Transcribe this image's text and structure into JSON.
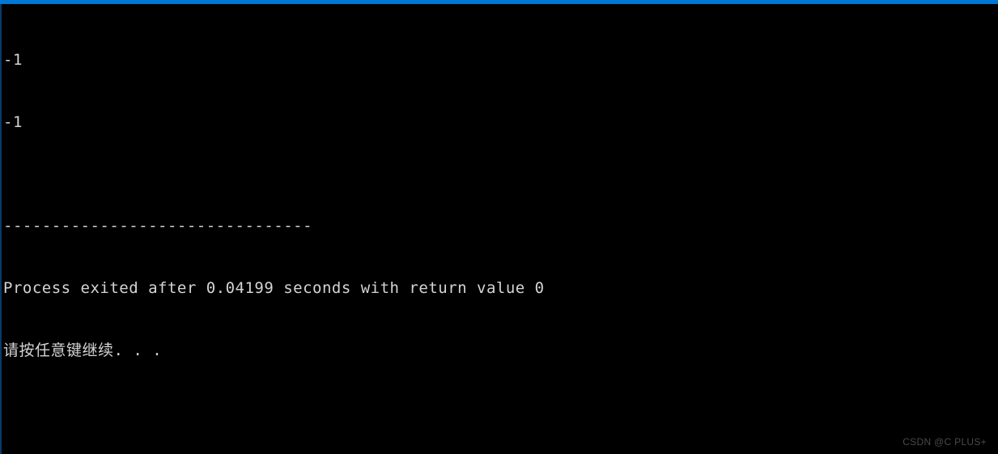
{
  "terminal": {
    "lines": [
      "-1",
      "-1",
      "",
      "--------------------------------",
      "Process exited after 0.04199 seconds with return value 0",
      "请按任意键继续. . ."
    ]
  },
  "watermark": {
    "text": "CSDN @C PLUS+"
  }
}
